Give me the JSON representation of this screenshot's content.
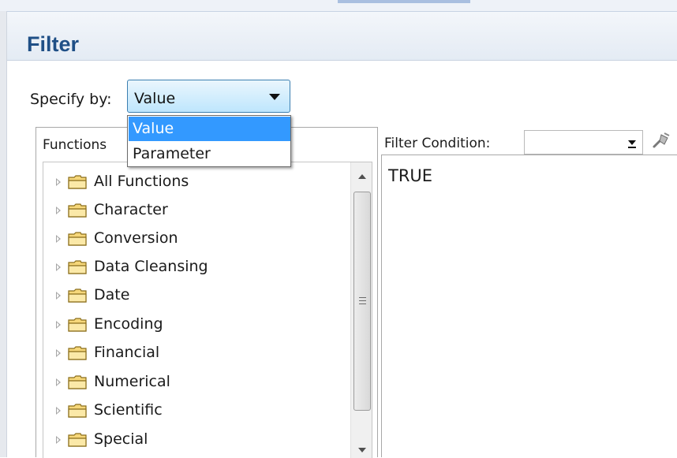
{
  "header": {
    "title": "Filter"
  },
  "specify": {
    "label": "Specify by:",
    "selected": "Value",
    "options": [
      "Value",
      "Parameter"
    ]
  },
  "functions_panel": {
    "label": "Functions",
    "items": [
      {
        "label": "All Functions",
        "icon": "folder-icon"
      },
      {
        "label": "Character",
        "icon": "folder-icon"
      },
      {
        "label": "Conversion",
        "icon": "folder-icon"
      },
      {
        "label": "Data Cleansing",
        "icon": "folder-icon"
      },
      {
        "label": "Date",
        "icon": "folder-icon"
      },
      {
        "label": "Encoding",
        "icon": "folder-icon"
      },
      {
        "label": "Financial",
        "icon": "folder-icon"
      },
      {
        "label": "Numerical",
        "icon": "folder-icon"
      },
      {
        "label": "Scientific",
        "icon": "folder-icon"
      },
      {
        "label": "Special",
        "icon": "folder-icon"
      }
    ]
  },
  "condition": {
    "label": "Filter Condition:",
    "combo_value": "",
    "text": "TRUE"
  },
  "colors": {
    "title": "#1f4f86",
    "selection": "#3399ff",
    "combo_border": "#3c7fb1"
  }
}
